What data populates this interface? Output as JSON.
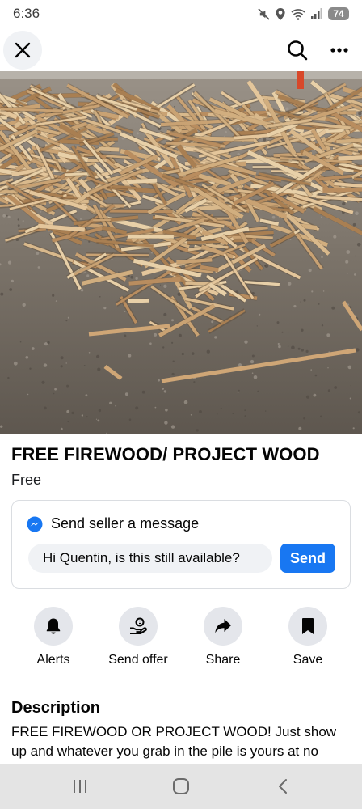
{
  "status_bar": {
    "time": "6:36",
    "battery": "74"
  },
  "top_bar": {
    "close_icon": "close-icon",
    "search_icon": "search-icon",
    "more_icon": "more-dots-icon"
  },
  "photo": {
    "subject": "pile of scrap firewood on gravel",
    "page_count": 2,
    "current_page": 1
  },
  "listing": {
    "title": "FREE FIREWOOD/ PROJECT WOOD",
    "price": "Free"
  },
  "message": {
    "heading": "Send seller a message",
    "input_value": "Hi Quentin, is this still available?",
    "send_label": "Send",
    "accent": "#1877f2"
  },
  "actions": [
    {
      "label": "Alerts",
      "icon": "bell-icon"
    },
    {
      "label": "Send offer",
      "icon": "offer-icon"
    },
    {
      "label": "Share",
      "icon": "share-icon"
    },
    {
      "label": "Save",
      "icon": "bookmark-icon"
    }
  ],
  "description": {
    "heading": "Description",
    "text": "FREE FIREWOOD OR PROJECT WOOD! Just show up and whatever you grab in the pile is yours at no"
  },
  "nav": {
    "recents_icon": "recents-icon",
    "home_icon": "home-icon",
    "back_icon": "back-icon"
  }
}
